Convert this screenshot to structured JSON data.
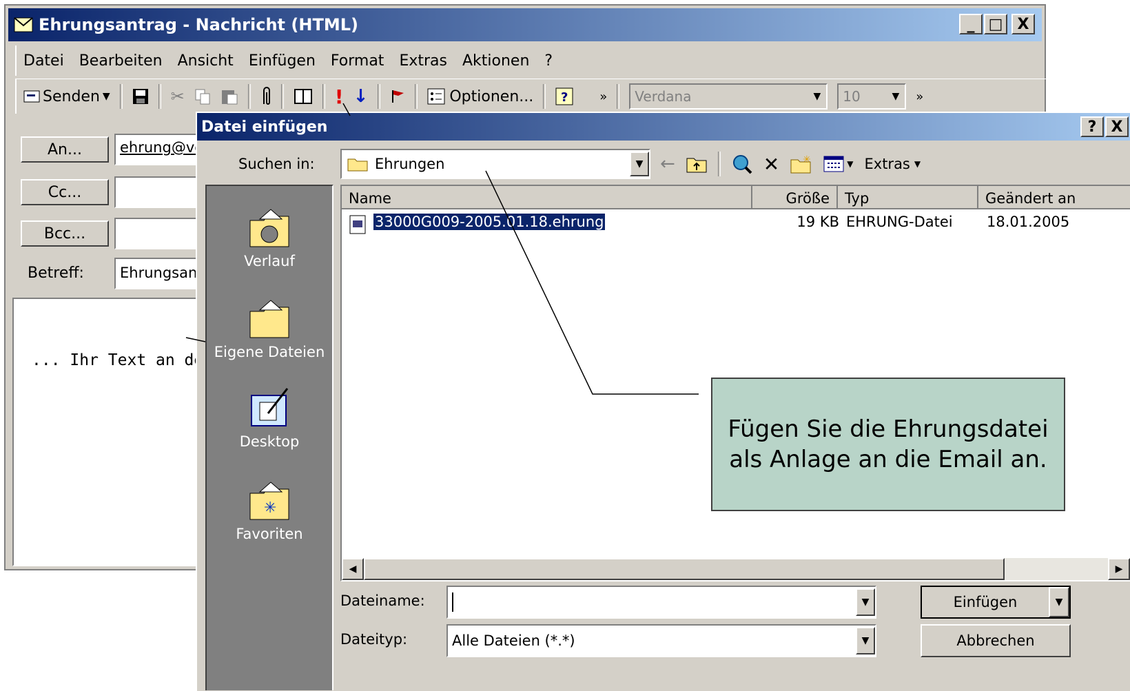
{
  "message_window": {
    "title": "Ehrungsantrag - Nachricht (HTML)",
    "caption_buttons": [
      "_",
      "□",
      "X"
    ],
    "menu": [
      "Datei",
      "Bearbeiten",
      "Ansicht",
      "Einfügen",
      "Format",
      "Extras",
      "Aktionen",
      "?"
    ],
    "toolbar": {
      "send_label": "Senden",
      "options_label": "Optionen...",
      "font_name": "Verdana",
      "font_size": "10"
    },
    "fields": {
      "to_button": "An...",
      "to_value": "ehrung@ve",
      "cc_button": "Cc...",
      "cc_value": "",
      "bcc_button": "Bcc...",
      "bcc_value": "",
      "subject_label": "Betreff:",
      "subject_value": "Ehrungsant"
    },
    "body_text": "... Ihr Text an de"
  },
  "dialog": {
    "title": "Datei einfügen",
    "help_button": "?",
    "close_button": "X",
    "look_in_label": "Suchen in:",
    "look_in_value": "Ehrungen",
    "tools_label": "Extras",
    "places": [
      "Verlauf",
      "Eigene Dateien",
      "Desktop",
      "Favoriten"
    ],
    "columns": [
      "Name",
      "Größe",
      "Typ",
      "Geändert an"
    ],
    "files": [
      {
        "name": "33000G009-2005.01.18.ehrung",
        "size": "19 KB",
        "type": "EHRUNG-Datei",
        "modified": "18.01.2005"
      }
    ],
    "filename_label": "Dateiname:",
    "filename_value": "",
    "filetype_label": "Dateityp:",
    "filetype_value": "Alle Dateien (*.*)",
    "insert_button": "Einfügen",
    "cancel_button": "Abbrechen"
  },
  "callout": {
    "text": "Fügen Sie die Ehrungsdatei als Anlage an die Email an."
  },
  "colors": {
    "titlebar_start": "#0a246a",
    "titlebar_end": "#a6caf0",
    "face": "#d4d0c8",
    "placebar": "#808080",
    "selection": "#0a246a",
    "callout_bg": "#b8d4c8"
  }
}
